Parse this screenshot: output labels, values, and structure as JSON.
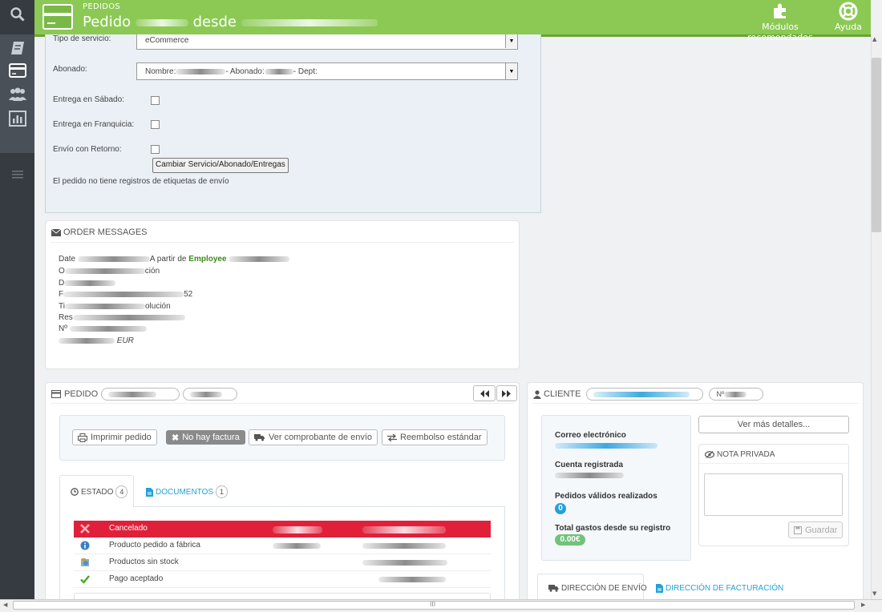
{
  "header": {
    "breadcrumb": "PEDIDOS",
    "title_prefix": "Pedido",
    "title_mid": "desde",
    "recommended_modules": "Módulos recomendados",
    "help": "Ayuda",
    "brand_color": "#8bc954"
  },
  "shipping_form": {
    "service_label": "Tipo de servicio:",
    "service_value": "eCommerce",
    "account_label": "Abonado:",
    "account_name_prefix": "Nombre:",
    "account_number_prefix": "- Abonado:",
    "account_dept_prefix": "- Dept:",
    "saturday_label": "Entrega en Sábado:",
    "franchise_label": "Entrega en Franquicia:",
    "return_label": "Envío con Retorno:",
    "change_button": "Cambiar Servicio/Abonado/Entregas",
    "no_labels_text": "El pedido no tiene registros de etiquetas de envío"
  },
  "order_messages": {
    "heading": "ORDER MESSAGES",
    "date_prefix": "Date",
    "from_text": "A partir de",
    "employee": "Employee",
    "line2_suffix": "ción",
    "line3_prefix": "D",
    "line4_prefix": "F",
    "line4_suffix": "52",
    "line5_prefix": "Ti",
    "line5_suffix": "olución",
    "line6_prefix": "Res",
    "line7_prefix": "Nº",
    "line8_suffix": "EUR"
  },
  "order": {
    "heading": "PEDIDO",
    "print_button": "Imprimir pedido",
    "no_invoice_button": "No hay factura",
    "shipping_slip_button": "Ver comprobante de envío",
    "refund_button": "Reembolso estándar",
    "tab_status": "ESTADO",
    "tab_status_count": "4",
    "tab_documents": "DOCUMENTOS",
    "tab_documents_count": "1",
    "statuses": [
      {
        "label": "Cancelado",
        "highlight": true,
        "icon": "cancel-icon"
      },
      {
        "label": "Producto pedido a fábrica",
        "highlight": false,
        "icon": "info-icon"
      },
      {
        "label": "Productos sin stock",
        "highlight": false,
        "icon": "stock-icon"
      },
      {
        "label": "Pago aceptado",
        "highlight": false,
        "icon": "check-icon"
      }
    ]
  },
  "customer": {
    "heading": "CLIENTE",
    "number_prefix": "Nº",
    "more_details_button": "Ver más detalles...",
    "email_label": "Correo electrónico",
    "registered_label": "Cuenta registrada",
    "valid_orders_label": "Pedidos válidos realizados",
    "valid_orders_value": "0",
    "total_spent_label": "Total gastos desde su registro",
    "total_spent_value": "0.00€",
    "private_note_heading": "NOTA PRIVADA",
    "save_button": "Guardar",
    "tab_shipping_address": "DIRECCIÓN DE ENVÍO",
    "tab_billing_address": "DIRECCIÓN DE FACTURACIÓN"
  },
  "scrollbar": {
    "grip": "III"
  }
}
